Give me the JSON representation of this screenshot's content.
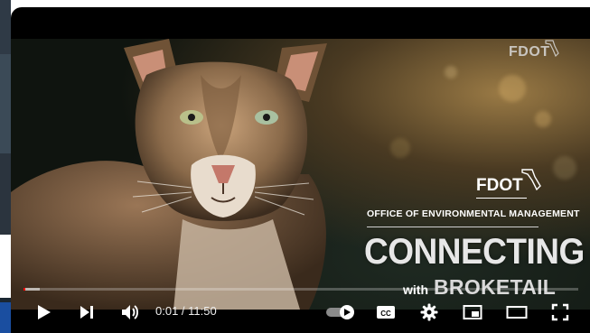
{
  "player": {
    "time_current": "0:01",
    "time_separator": " / ",
    "time_total": "11:50",
    "progress_fraction": 0.0014,
    "buffer_fraction": 0.03,
    "autoplay_on": true
  },
  "video": {
    "watermark": "FDOT",
    "brand": "FDOT",
    "office_line": "OFFICE OF ENVIRONMENTAL MANAGEMENT",
    "title_main": "CONNECTING",
    "title_with": "with",
    "title_name": "BROKETAIL"
  },
  "controls": {
    "cc_label": "CC",
    "icons": [
      "play-icon",
      "next-icon",
      "volume-icon",
      "autoplay-toggle-icon",
      "captions-icon",
      "settings-icon",
      "miniplayer-icon",
      "theater-icon",
      "fullscreen-icon"
    ]
  },
  "colors": {
    "progress": "#ff0000",
    "player_bg": "#000000",
    "left_strip": "#1b2733"
  }
}
